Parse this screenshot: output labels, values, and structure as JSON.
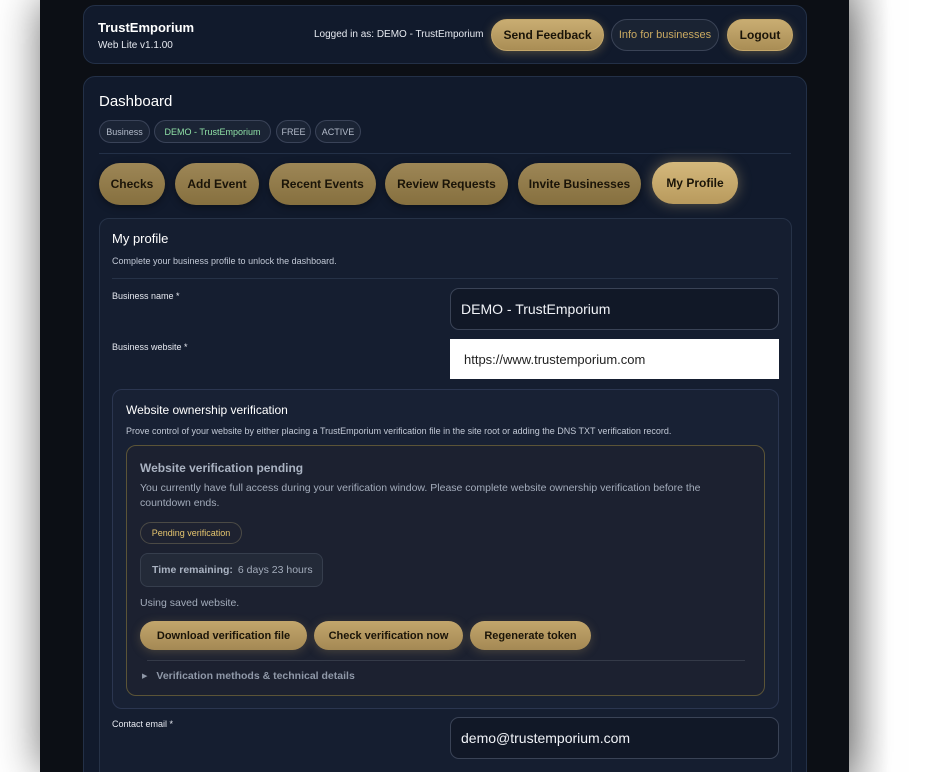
{
  "header": {
    "brand": "TrustEmporium",
    "version": "Web Lite v1.1.00",
    "logged_in": "Logged in as: DEMO - TrustEmporium",
    "feedback_label": "Send Feedback",
    "info_label": "Info for businesses",
    "logout_label": "Logout"
  },
  "dashboard": {
    "title": "Dashboard",
    "badges": [
      "Business",
      "DEMO - TrustEmporium",
      "FREE",
      "ACTIVE"
    ],
    "tabs": [
      "Checks",
      "Add Event",
      "Recent Events",
      "Review Requests",
      "Invite Businesses",
      "My Profile"
    ],
    "active_tab": "My Profile"
  },
  "profile": {
    "title": "My profile",
    "subtitle": "Complete your business profile to unlock the dashboard.",
    "business_name_label": "Business name *",
    "business_name_value": "DEMO - TrustEmporium",
    "business_website_label": "Business website *",
    "business_website_value": "https://www.trustemporium.com",
    "contact_email_label": "Contact email *",
    "contact_email_value": "demo@trustemporium.com"
  },
  "verification": {
    "title": "Website ownership verification",
    "description": "Prove control of your website by either placing a TrustEmporium verification file in the site root or adding the DNS TXT verification record.",
    "pending_title": "Website verification pending",
    "pending_text": "You currently have full access during your verification window. Please complete website ownership verification before the countdown ends.",
    "status_badge": "Pending verification",
    "time_label": "Time remaining:",
    "time_value": "6 days 23 hours",
    "saved_text": "Using saved website.",
    "download_label": "Download verification file",
    "check_label": "Check verification now",
    "regenerate_label": "Regenerate token",
    "details_label": "Verification methods & technical details"
  },
  "colors": {
    "accent_gold": "#c9ad72",
    "panel_bg": "#111a2c",
    "pending_text": "#e5c56f",
    "business_badge_green": "#8fe0a6"
  }
}
